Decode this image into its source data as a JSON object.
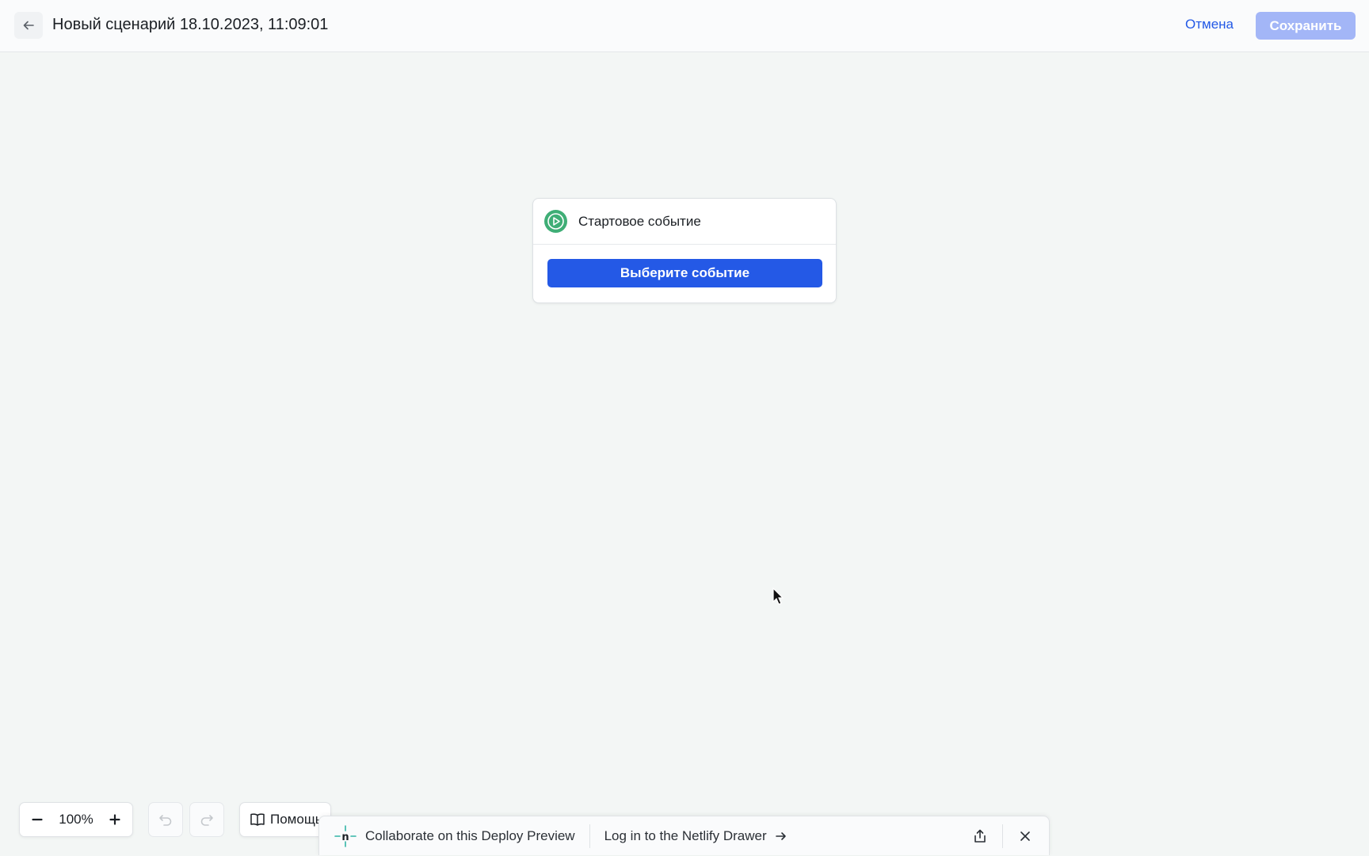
{
  "header": {
    "title": "Новый сценарий 18.10.2023, 11:09:01",
    "cancel_label": "Отмена",
    "save_label": "Сохранить"
  },
  "node": {
    "title": "Стартовое событие",
    "button_label": "Выберите событие"
  },
  "toolbar": {
    "zoom_value": "100%",
    "help_label": "Помощь"
  },
  "netlify": {
    "collaborate_label": "Collaborate on this Deploy Preview",
    "login_label": "Log in to the Netlify Drawer"
  },
  "colors": {
    "accent": "#2459e6",
    "save_disabled": "#a3b6f7",
    "start_event": "#3fae76",
    "canvas": "#f3f6f5"
  },
  "icons": [
    "arrow-left-icon",
    "play-icon",
    "minus-icon",
    "plus-icon",
    "undo-icon",
    "redo-icon",
    "book-icon",
    "netlify-logo-icon",
    "arrow-right-icon",
    "share-icon",
    "close-icon",
    "mouse-cursor-icon"
  ]
}
